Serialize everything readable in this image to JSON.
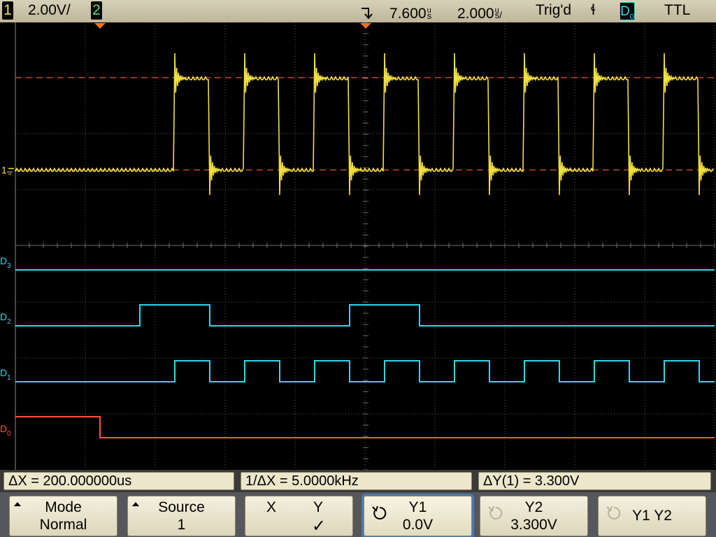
{
  "topbar": {
    "ch1_number": "1",
    "ch1_scale": "2.00V/",
    "ch2_number": "2",
    "trigger_delay": "7.600",
    "delay_unit": "s",
    "delay_unit_prefix": "u",
    "time_scale": "2.000",
    "time_scale_unit": "s/",
    "time_scale_prefix": "u",
    "trigger_status": "Trig'd",
    "trigger_edge_symbol": "ɬ",
    "trigger_source_main": "D",
    "trigger_source_sub": "0",
    "trigger_level": "TTL"
  },
  "display": {
    "ch1_marker": "1",
    "digital_labels": [
      {
        "main": "D",
        "sub": "3"
      },
      {
        "main": "D",
        "sub": "2"
      },
      {
        "main": "D",
        "sub": "1"
      },
      {
        "main": "D",
        "sub": "0"
      }
    ],
    "colors": {
      "ch1": "#f0e040",
      "digital": "#30d8e8",
      "d0": "#ff5040",
      "grid": "#5a5a5a",
      "cursor": "#e05a2a"
    },
    "ch1_cursor_levels_v": {
      "y1": 0.0,
      "y2": 3.3
    },
    "ch1_reference_volts_per_div": 2.0,
    "time_per_div_us": 2.0
  },
  "measurements": {
    "delta_x": "ΔX = 200.000000us",
    "inv_delta_x": "1/ΔX = 5.0000kHz",
    "delta_y": "ΔY(1) = 3.300V"
  },
  "softkeys": {
    "mode": {
      "label": "Mode",
      "value": "Normal"
    },
    "source": {
      "label": "Source",
      "value": "1"
    },
    "xy": {
      "x_label": "X",
      "y_label": "Y",
      "check": "✓"
    },
    "y1": {
      "label": "Y1",
      "value": "0.0V"
    },
    "y2": {
      "label": "Y2",
      "value": "3.300V"
    },
    "y1y2": {
      "label": "Y1 Y2"
    }
  }
}
